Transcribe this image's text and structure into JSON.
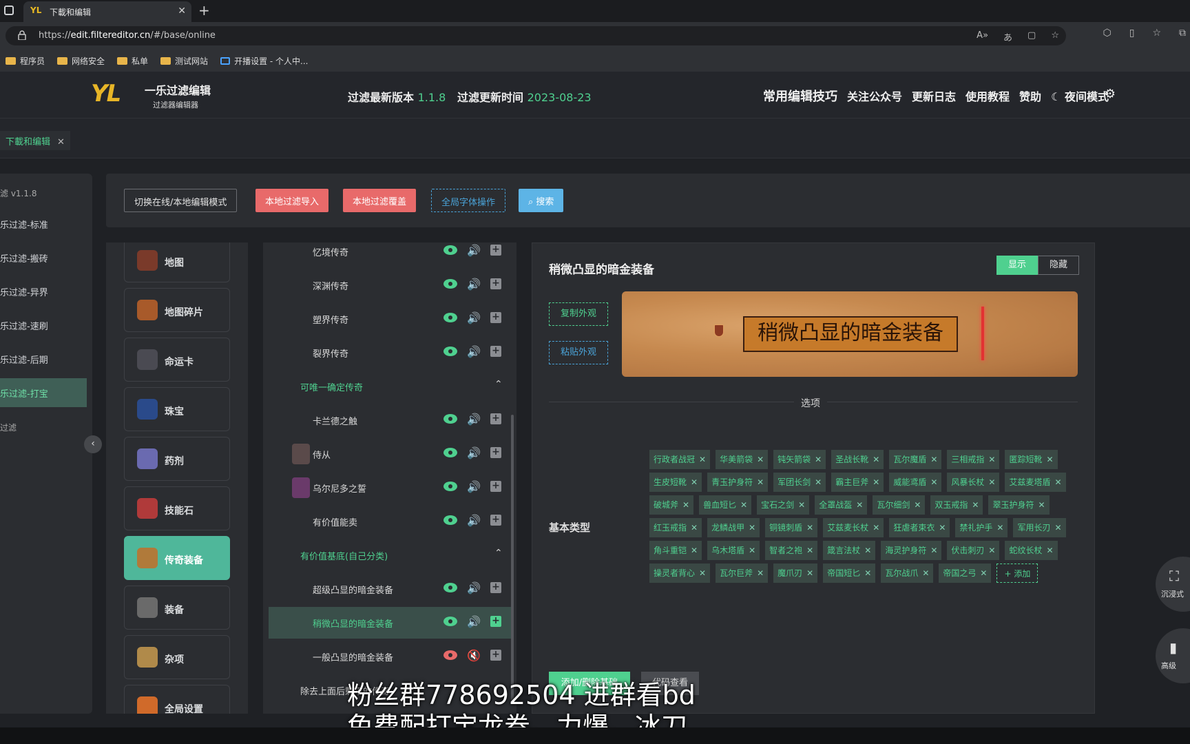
{
  "browser": {
    "tab_title": "下載和编辑",
    "tab_favicon": "YL",
    "url_prefix": "https://",
    "url_host": "edit.filtereditor.cn",
    "url_path": "/#/base/online",
    "bookmarks": [
      "程序员",
      "网络安全",
      "私单",
      "测试网站",
      "开播设置 - 个人中..."
    ]
  },
  "app": {
    "logo": "YL",
    "name": "一乐过滤编辑",
    "subtitle": "过滤器编辑器",
    "version_label": "过滤最新版本",
    "version": "1.1.8",
    "update_label": "过滤更新时间",
    "update_date": "2023-08-23",
    "nav": [
      "常用编辑技巧",
      "关注公众号",
      "更新日志",
      "使用教程",
      "赞助",
      "夜间模式"
    ]
  },
  "page_tab": {
    "label": "下載和编辑"
  },
  "sidebar": {
    "version": "滤 v1.1.8",
    "items": [
      "乐过滤-标准",
      "乐过滤-搬砖",
      "乐过滤-异界",
      "乐过滤-速刷",
      "乐过滤-后期",
      "乐过滤-打宝"
    ],
    "footer": "过滤",
    "active_index": 5
  },
  "toolbar": {
    "switch_mode": "切换在线/本地编辑模式",
    "local_import": "本地过滤导入",
    "local_overwrite": "本地过滤覆盖",
    "global_font": "全局字体操作",
    "search": "搜索"
  },
  "categories": [
    {
      "label": "地图",
      "color": "#7a3a2a"
    },
    {
      "label": "地图碎片",
      "color": "#a85a2a"
    },
    {
      "label": "命运卡",
      "color": "#4a4a52"
    },
    {
      "label": "珠宝",
      "color": "#2a4a8a"
    },
    {
      "label": "药剂",
      "color": "#6a6ab0"
    },
    {
      "label": "技能石",
      "color": "#b03a3a"
    },
    {
      "label": "传奇装备",
      "color": "#b07a3a"
    },
    {
      "label": "装备",
      "color": "#6a6a6a"
    },
    {
      "label": "杂项",
      "color": "#b08a4a"
    },
    {
      "label": "全局设置",
      "color": "#d06a2a"
    }
  ],
  "list": [
    {
      "label": "忆境传奇",
      "type": "item"
    },
    {
      "label": "深渊传奇",
      "type": "item"
    },
    {
      "label": "塑界传奇",
      "type": "item"
    },
    {
      "label": "裂界传奇",
      "type": "item"
    },
    {
      "label": "可唯一确定传奇",
      "type": "group"
    },
    {
      "label": "卡兰德之触",
      "type": "item"
    },
    {
      "label": "侍从",
      "type": "item"
    },
    {
      "label": "乌尔尼多之誓",
      "type": "item"
    },
    {
      "label": "有价值能卖",
      "type": "item"
    },
    {
      "label": "有价值基底(自己分类)",
      "type": "group"
    },
    {
      "label": "超级凸显的暗金装备",
      "type": "item"
    },
    {
      "label": "稍微凸显的暗金装备",
      "type": "item",
      "selected": true
    },
    {
      "label": "一般凸显的暗金装备",
      "type": "item",
      "off": true
    },
    {
      "label": "除去上面后剩下的传奇",
      "type": "plain"
    }
  ],
  "detail": {
    "title": "稍微凸显的暗金装备",
    "show": "显示",
    "hide": "隐藏",
    "copy_style": "复制外观",
    "paste_style": "粘贴外观",
    "preview_text": "稍微凸显的暗金装备",
    "options_label": "选项",
    "basetype_label": "基本类型",
    "tags": [
      "行政者战冠",
      "华美箭袋",
      "钝矢箭袋",
      "圣战长靴",
      "瓦尔魔盾",
      "三相戒指",
      "匿踪短靴",
      "生皮短靴",
      "青玉护身符",
      "军团长剑",
      "霸主巨斧",
      "威能鸢盾",
      "风暴长杖",
      "艾兹麦塔盾",
      "破城斧",
      "兽血短匕",
      "宝石之剑",
      "全罩战盔",
      "瓦尔细剑",
      "双玉戒指",
      "翠玉护身符",
      "红玉戒指",
      "龙鳞战甲",
      "铜镜刺盾",
      "艾兹麦长杖",
      "狂虐者束衣",
      "禁礼护手",
      "军用长刃",
      "角斗重铠",
      "乌木塔盾",
      "智者之袍",
      "箴言法杖",
      "海灵护身符",
      "伏击刺刃",
      "蛇纹长杖",
      "操灵者背心",
      "瓦尔巨斧",
      "魔爪刃",
      "帝国短匕",
      "瓦尔战爪",
      "帝国之弓"
    ],
    "add_tag": "+ 添加",
    "bottom_primary": "添加/删除基础",
    "bottom_secondary": "代码查看"
  },
  "floating": [
    "沉浸式",
    "高级"
  ],
  "caption": {
    "line1": "粉丝群778692504 进群看bd",
    "line2": "免费配打宝龙卷、力爆、冰刀"
  }
}
